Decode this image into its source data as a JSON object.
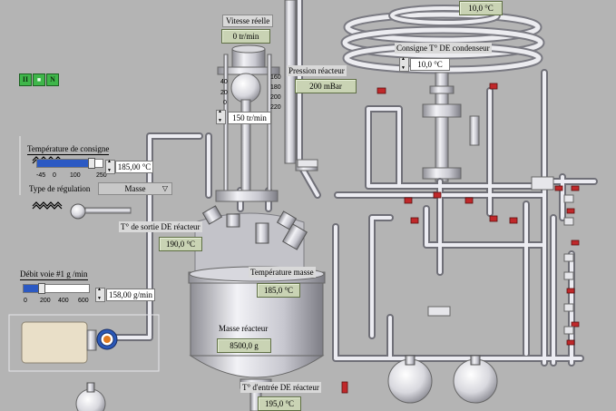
{
  "buttons": {
    "pause": "II",
    "play": "■",
    "stop": "N"
  },
  "vitesse": {
    "label": "Vitesse réelle",
    "value": "0 tr/min",
    "setpoint": "150 tr/min",
    "gauge_ticks": [
      "40",
      "20",
      "0",
      "160",
      "180",
      "200",
      "220"
    ]
  },
  "pression": {
    "label": "Pression réacteur",
    "value": "200 mBar"
  },
  "condenseur": {
    "label": "Consigne T° DE condenseur",
    "value": "10,0 °C",
    "top_value": "10,0 °C"
  },
  "consigne": {
    "label": "Température de consigne",
    "value": "185,00 °C",
    "ticks": [
      "-45",
      "0",
      "100",
      "250"
    ]
  },
  "regulation": {
    "label": "Type de régulation",
    "selected": "Masse"
  },
  "sortie": {
    "label": "T° de sortie DE réacteur",
    "value": "190,0 °C"
  },
  "masse_temp": {
    "label": "Température masse",
    "value": "185,0 °C"
  },
  "debit": {
    "label": "Débit voie #1 g /min",
    "value": "158,00 g/min",
    "ticks": [
      "0",
      "200",
      "400",
      "600"
    ]
  },
  "masse": {
    "label": "Masse réacteur",
    "value": "8500,0 g"
  },
  "entree": {
    "label": "T° d'entrée DE réacteur",
    "value": "195,0 °C"
  },
  "colors": {
    "background": "#b4b4b4",
    "display": "#c9d3b4",
    "valve_red": "#c0282a",
    "pump_blue": "#2a58b8",
    "pump_orange": "#e07a20"
  }
}
